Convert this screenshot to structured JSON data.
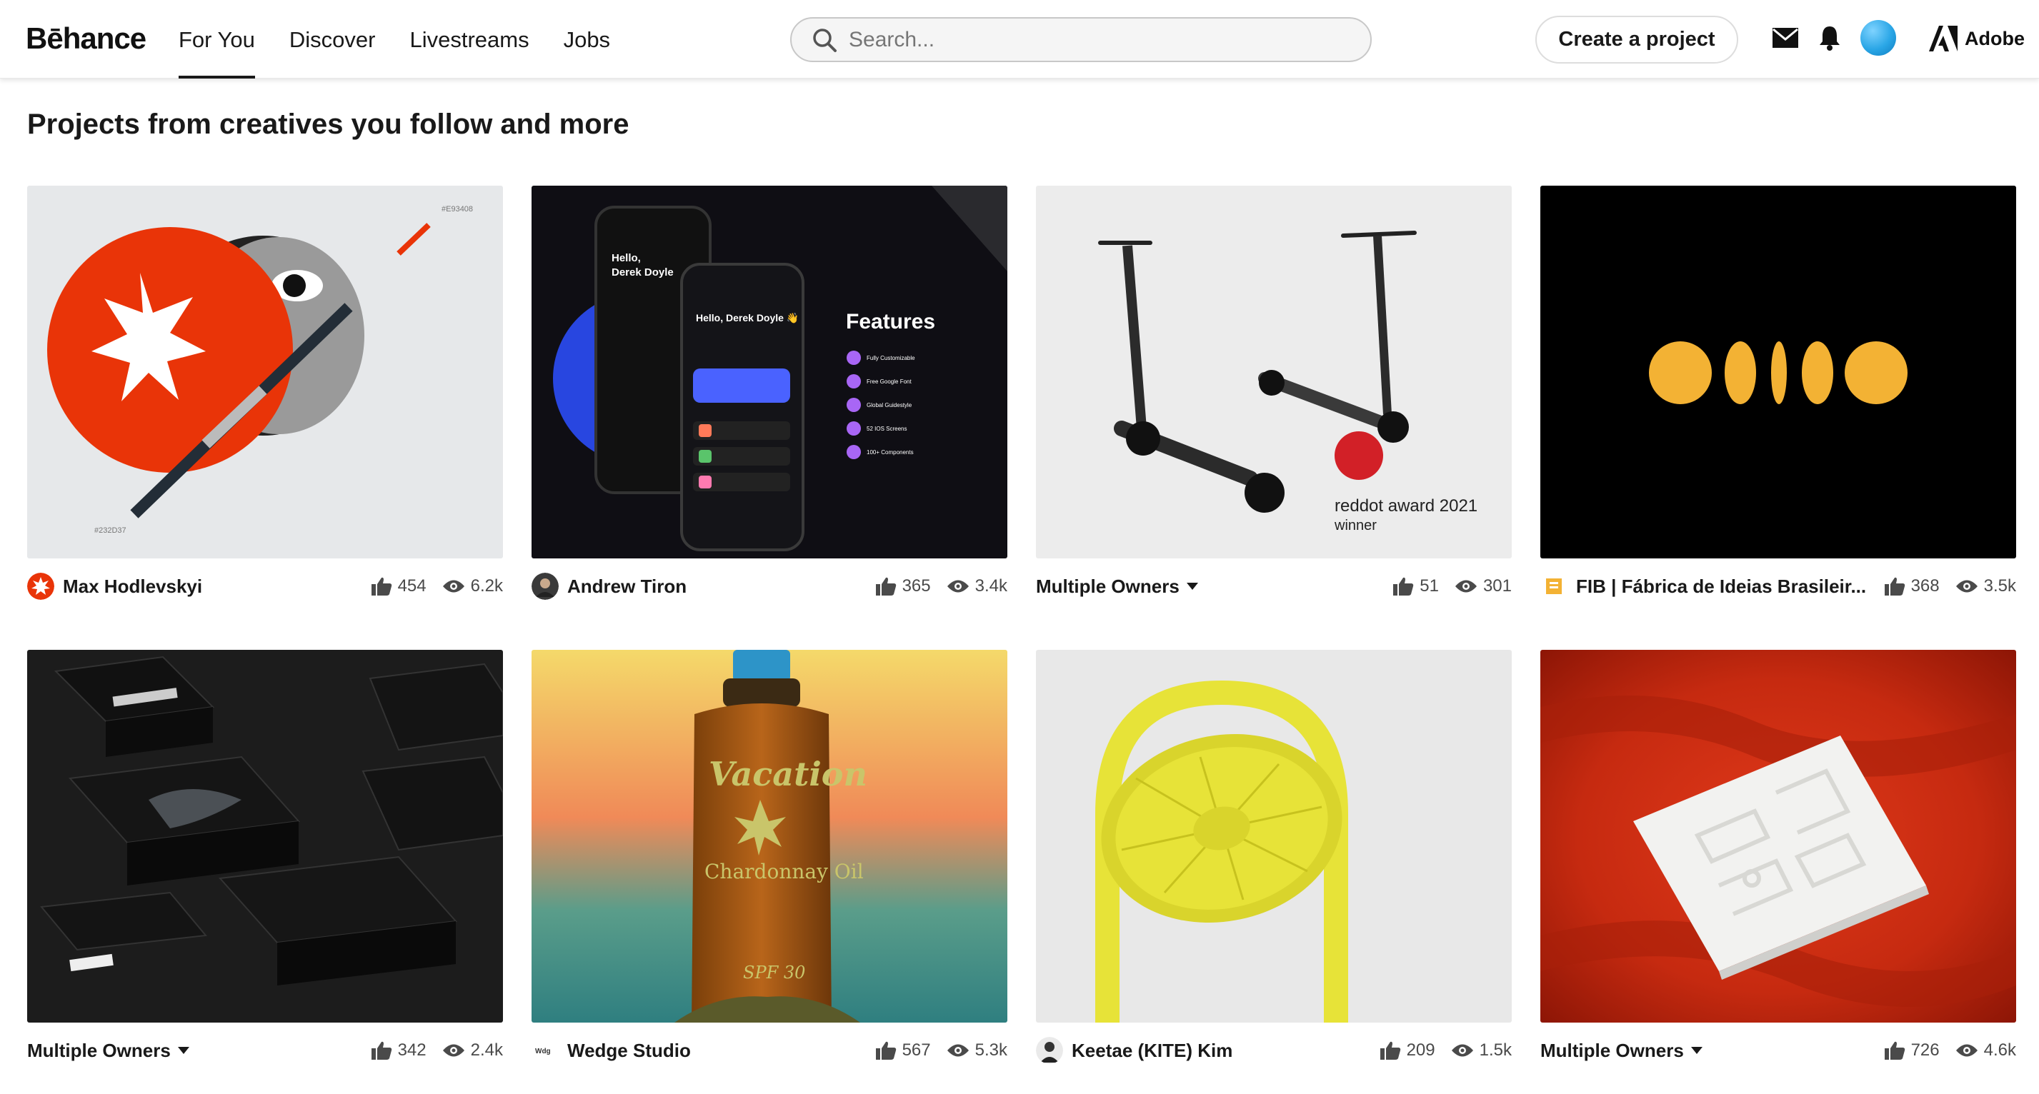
{
  "header": {
    "logo": "Bēhance",
    "nav": [
      "For You",
      "Discover",
      "Livestreams",
      "Jobs"
    ],
    "active_nav": "For You",
    "search_placeholder": "Search...",
    "create_button": "Create a project",
    "adobe_label": "Adobe"
  },
  "page": {
    "title": "Projects from creatives you follow and more"
  },
  "projects": [
    {
      "owner": "Max Hodlevskyi",
      "likes": "454",
      "views": "6.2k",
      "thumb_texts": [
        "#E93408",
        "#232D37"
      ]
    },
    {
      "owner": "Andrew Tiron",
      "likes": "365",
      "views": "3.4k",
      "thumb_texts": [
        "Features",
        "Hello, Derek Doyle 👋",
        "Fully Customizable",
        "Free Google Font",
        "Global Guidestyle",
        "52 IOS Screens",
        "100+ Components"
      ]
    },
    {
      "owner": "Multiple Owners",
      "likes": "51",
      "views": "301",
      "thumb_texts": [
        "reddot award 2021",
        "winner"
      ]
    },
    {
      "owner": "FIB | Fábrica de Ideias Brasileir...",
      "likes": "368",
      "views": "3.5k",
      "thumb_texts": []
    },
    {
      "owner": "Multiple Owners",
      "likes": "342",
      "views": "2.4k",
      "thumb_texts": []
    },
    {
      "owner": "Wedge Studio",
      "likes": "567",
      "views": "5.3k",
      "thumb_texts": [
        "Vacation",
        "Chardonnay Oil",
        "SPF 30"
      ]
    },
    {
      "owner": "Keetae (KITE) Kim",
      "likes": "209",
      "views": "1.5k",
      "thumb_texts": []
    },
    {
      "owner": "Multiple Owners",
      "likes": "726",
      "views": "4.6k",
      "thumb_texts": []
    }
  ],
  "colors": {
    "accent": "#191919",
    "search_bg": "#f5f5f5",
    "max_red": "#e93408",
    "fib_yellow": "#f3b234",
    "card3_bg": "#ececec",
    "fan_yellow": "#e7e338"
  },
  "icons": [
    "search-icon",
    "mail-icon",
    "bell-icon",
    "adobe-icon",
    "thumbs-up-icon",
    "eye-icon",
    "chevron-down-icon"
  ]
}
